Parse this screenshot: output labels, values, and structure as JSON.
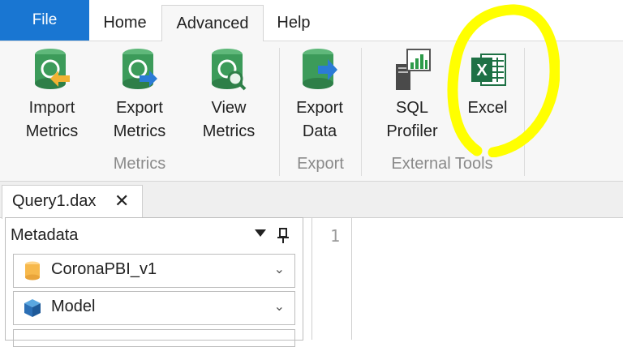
{
  "tabs": [
    {
      "label": "File"
    },
    {
      "label": "Home"
    },
    {
      "label": "Advanced"
    },
    {
      "label": "Help"
    }
  ],
  "ribbon": {
    "buttons": [
      {
        "label": "Import\nMetrics",
        "icon": "import-metrics-icon"
      },
      {
        "label": "Export\nMetrics",
        "icon": "export-metrics-icon"
      },
      {
        "label": "View\nMetrics",
        "icon": "view-metrics-icon"
      },
      {
        "label": "Export\nData",
        "icon": "export-data-icon"
      },
      {
        "label": "SQL\nProfiler",
        "icon": "sql-profiler-icon"
      },
      {
        "label": "Excel",
        "icon": "excel-icon"
      }
    ],
    "groups": [
      "Metrics",
      "Export",
      "External Tools"
    ]
  },
  "document": {
    "tab_label": "Query1.dax",
    "close_glyph": "✕"
  },
  "metadata": {
    "title": "Metadata",
    "database": "CoronaPBI_v1",
    "model": "Model",
    "chevron": "⌄"
  },
  "editor": {
    "line_number": "1"
  },
  "colors": {
    "file_tab": "#1976d2",
    "highlight": "#ffff00",
    "icon_green": "#3c9b5a",
    "excel_green": "#1e7145"
  }
}
